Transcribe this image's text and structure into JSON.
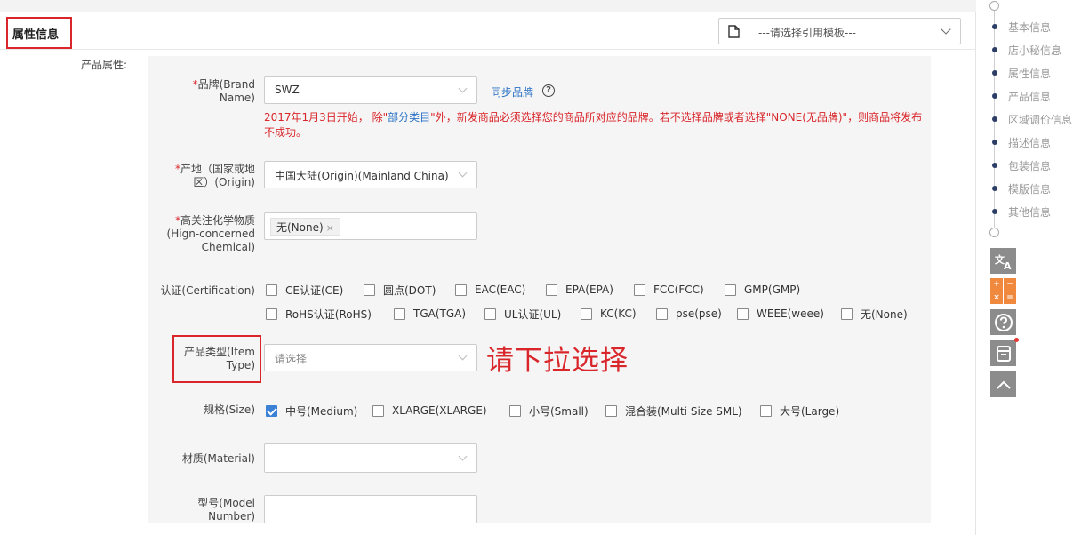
{
  "header": {
    "section_title": "属性信息",
    "template_select_value": "---请选择引用模板---"
  },
  "attributes": {
    "label": "产品属性:",
    "brand": {
      "required_mark": "*",
      "label": "品牌(Brand Name)",
      "value": "SWZ",
      "sync_link": "同步品牌",
      "warning_prefix": "2017年1月3日开始， 除\"",
      "warning_link": "部分类目",
      "warning_suffix": "\"外，新发商品必须选择您的商品所对应的品牌。若不选择品牌或者选择\"NONE(无品牌)\"，则商品将发布不成功。"
    },
    "origin": {
      "required_mark": "*",
      "label": "产地（国家或地区）(Origin)",
      "value": "中国大陆(Origin)(Mainland China)"
    },
    "chemical": {
      "required_mark": "*",
      "label": "高关注化学物质(Hign-concerned Chemical)",
      "tag": "无(None)",
      "tag_remove": "×"
    },
    "certification": {
      "label": "认证(Certification)",
      "options": [
        {
          "label": "CE认证(CE)",
          "checked": false
        },
        {
          "label": "圆点(DOT)",
          "checked": false
        },
        {
          "label": "EAC(EAC)",
          "checked": false
        },
        {
          "label": "EPA(EPA)",
          "checked": false
        },
        {
          "label": "FCC(FCC)",
          "checked": false
        },
        {
          "label": "GMP(GMP)",
          "checked": false
        },
        {
          "label": "RoHS认证(RoHS)",
          "checked": false
        },
        {
          "label": "TGA(TGA)",
          "checked": false
        },
        {
          "label": "UL认证(UL)",
          "checked": false
        },
        {
          "label": "KC(KC)",
          "checked": false
        },
        {
          "label": "pse(pse)",
          "checked": false
        },
        {
          "label": "WEEE(weee)",
          "checked": false
        },
        {
          "label": "无(None)",
          "checked": false
        }
      ]
    },
    "item_type": {
      "label": "产品类型(Item Type)",
      "placeholder": "请选择",
      "hint": "请下拉选择"
    },
    "size": {
      "label": "规格(Size)",
      "options": [
        {
          "label": "中号(Medium)",
          "checked": true
        },
        {
          "label": "XLARGE(XLARGE)",
          "checked": false
        },
        {
          "label": "小号(Small)",
          "checked": false
        },
        {
          "label": "混合装(Multi Size SML)",
          "checked": false
        },
        {
          "label": "大号(Large)",
          "checked": false
        }
      ]
    },
    "material": {
      "label": "材质(Material)",
      "value": ""
    },
    "model_number": {
      "label": "型号(Model Number)",
      "value": ""
    }
  },
  "right_nav": {
    "items": [
      "基本信息",
      "店小秘信息",
      "属性信息",
      "产品信息",
      "区域调价信息",
      "描述信息",
      "包装信息",
      "模版信息",
      "其他信息"
    ],
    "calc_keys": [
      "+",
      "−",
      "×",
      "="
    ]
  }
}
